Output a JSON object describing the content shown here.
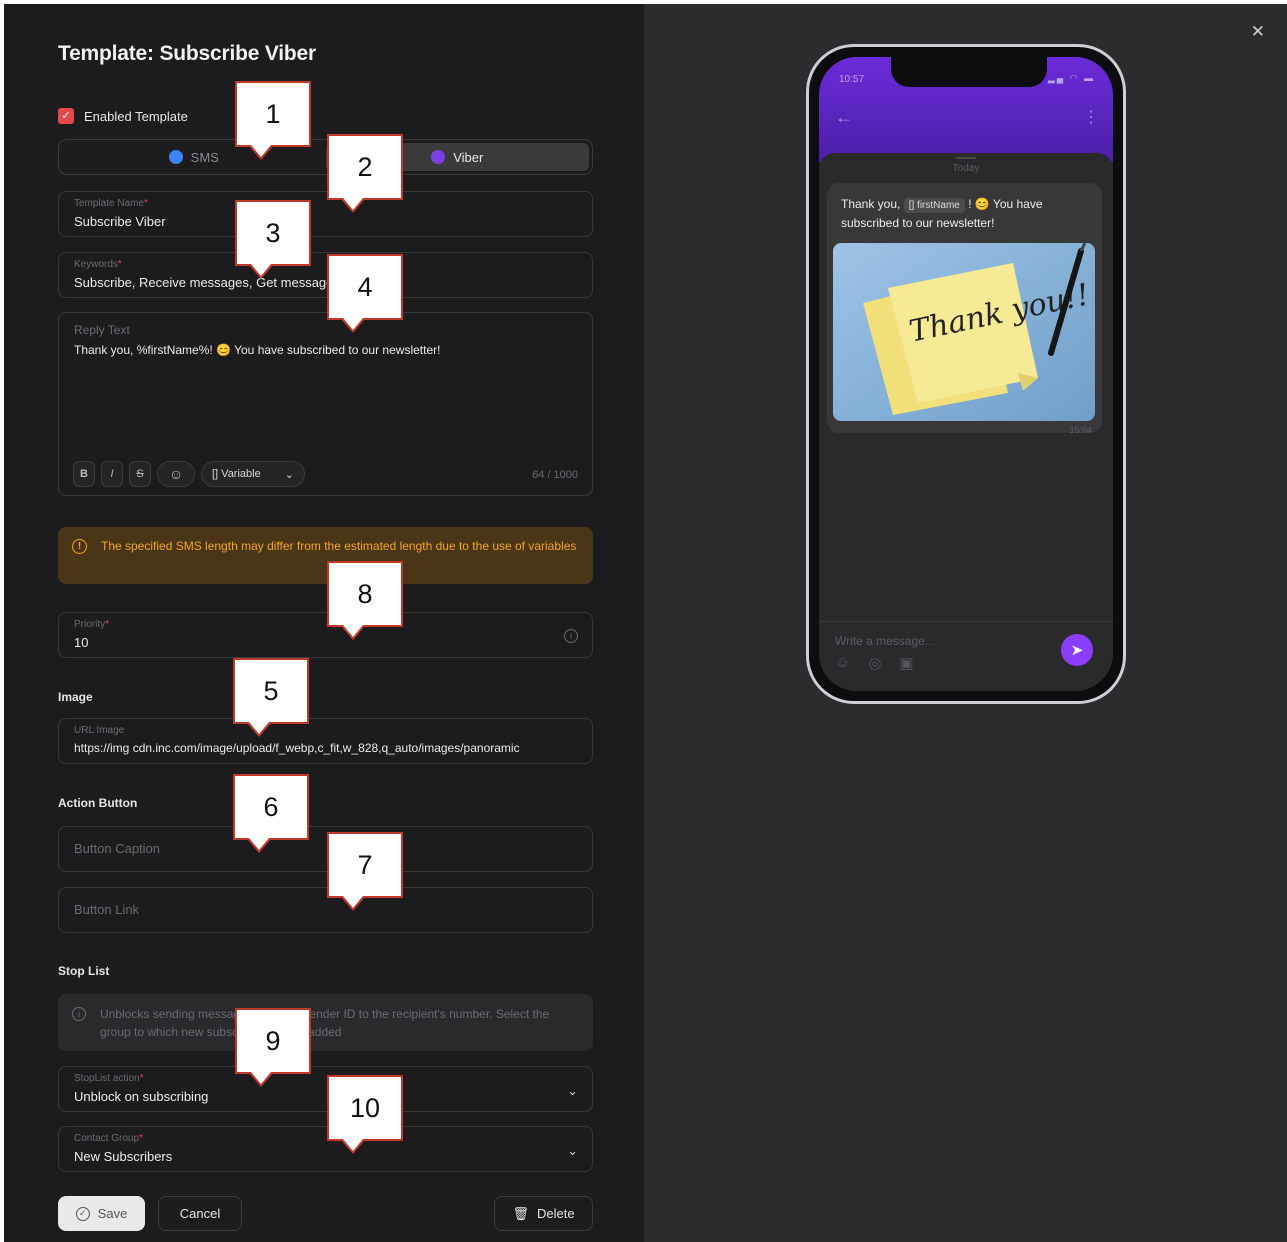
{
  "form": {
    "title": "Template: Subscribe Viber",
    "enabled_label": "Enabled Template",
    "tabs": [
      {
        "label": "SMS",
        "icon": "sms-icon",
        "active": false
      },
      {
        "label": "Viber",
        "icon": "viber-icon",
        "active": true
      }
    ],
    "template_name": {
      "label": "Template Name",
      "value": "Subscribe Viber"
    },
    "keywords": {
      "label": "Keywords",
      "value": "Subscribe, Receive messages, Get message"
    },
    "reply_text": {
      "label": "Reply Text",
      "value": "Thank you, %firstName%! 😊 You have subscribed to our newsletter!",
      "toolbar": {
        "bold": "B",
        "italic": "I",
        "strike": "S",
        "emoji": "☺",
        "variable": "[] Variable"
      },
      "counter": "64 / 1000"
    },
    "warning": "The specified SMS length may differ from the estimated length due to the use of variables",
    "priority": {
      "label": "Priority",
      "value": "10"
    },
    "image_section": "Image",
    "url_image": {
      "label": "URL Image",
      "value": "https://img cdn.inc.com/image/upload/f_webp,c_fit,w_828,q_auto/images/panoramic"
    },
    "action_section": "Action Button",
    "button_caption_placeholder": "Button Caption",
    "button_link_placeholder": "Button Link",
    "stop_section": "Stop List",
    "stop_info": "Unblocks sending messages from the sender ID to the recipient's number. Select the group to which new subscribers will be added",
    "stop_action": {
      "label": "StopList action",
      "value": "Unblock on subscribing"
    },
    "contact_group": {
      "label": "Contact Group",
      "value": "New Subscribers"
    },
    "buttons": {
      "save": "Save",
      "cancel": "Cancel",
      "delete": "Delete"
    }
  },
  "preview": {
    "time": "10:57",
    "today": "Today",
    "message_prefix": "Thank you,",
    "message_chip": "[] firstName",
    "message_suffix": "! 😊 You have subscribed to our newsletter!",
    "image_text": "Thank you!!",
    "msg_time": "15:04",
    "input_placeholder": "Write a message..."
  },
  "callouts": [
    "1",
    "2",
    "3",
    "4",
    "5",
    "6",
    "7",
    "8",
    "9",
    "10"
  ],
  "colors": {
    "accent_red": "#e5484d",
    "viber_purple": "#7b3fe4",
    "warning": "#f5a524",
    "callout_border": "#c0392b"
  }
}
